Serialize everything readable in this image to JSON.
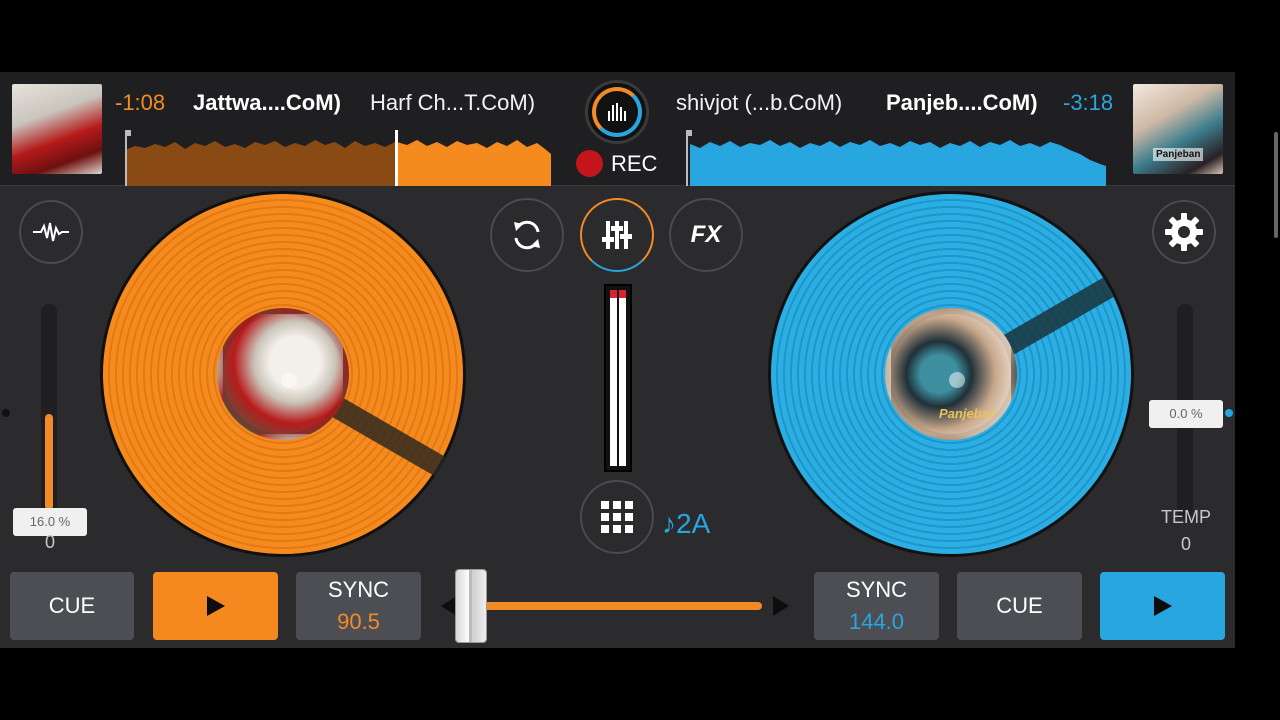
{
  "colors": {
    "deck_a": "#f28a26",
    "deck_b": "#27a6e0",
    "background": "#2b2b2e",
    "record": "#c4151c"
  },
  "deck_a": {
    "time_remaining": "-1:08",
    "title": "Jattwa....CoM)",
    "artist": "Harf Ch...T.CoM)",
    "pitch_value": "16.0 %",
    "pitch_level": 0.45,
    "tempo_zero": "0",
    "cue_label": "CUE",
    "play_icon": "play-icon",
    "sync_label": "SYNC",
    "bpm": "90.5",
    "waveform_progress": 0.64
  },
  "deck_b": {
    "time_remaining": "-3:18",
    "title": "Panjeb....CoM)",
    "artist": "shivjot (...b.CoM)",
    "pitch_value": "0.0 %",
    "pitch_level": 0.0,
    "tempo_label": "TEMP",
    "tempo_zero": "0",
    "cue_label": "CUE",
    "play_icon": "play-icon",
    "sync_label": "SYNC",
    "bpm": "144.0",
    "label_text": "Panjeban",
    "waveform_progress": 0.01
  },
  "center": {
    "record_label": "REC",
    "fx_label": "FX",
    "key_label": "♪2A",
    "crossfader_position": 0.04
  },
  "icons": {
    "logo": "equalizer-logo-icon",
    "record": "record-dot-icon",
    "waveform_toggle": "waveform-icon",
    "settings": "gear-icon",
    "sync_loop": "refresh-icon",
    "mixer": "mixer-sliders-icon",
    "sampler": "grid-icon"
  }
}
